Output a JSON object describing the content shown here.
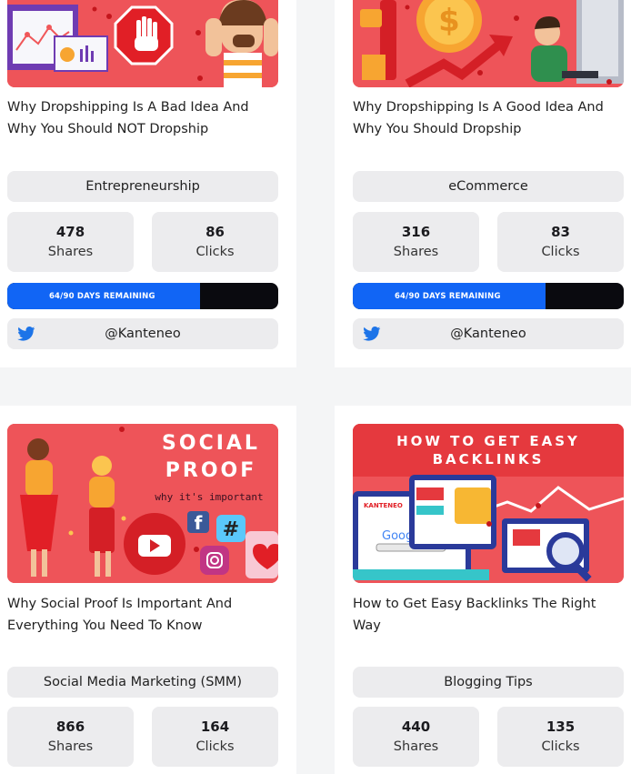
{
  "cards": [
    {
      "title_line1": "Why Dropshipping Is A Bad Idea And",
      "title_line2": "Why You Should NOT Dropship",
      "category": "Entrepreneurship",
      "shares": "478",
      "shares_label": "Shares",
      "clicks": "86",
      "clicks_label": "Clicks",
      "progress_text": "64/90 DAYS REMAINING",
      "progress_fraction": 0.71,
      "twitter_handle": "@Kanteneo"
    },
    {
      "title_line1": "Why Dropshipping Is A Good Idea And",
      "title_line2": "Why You Should Dropship",
      "category": "eCommerce",
      "shares": "316",
      "shares_label": "Shares",
      "clicks": "83",
      "clicks_label": "Clicks",
      "progress_text": "64/90 DAYS REMAINING",
      "progress_fraction": 0.71,
      "twitter_handle": "@Kanteneo"
    },
    {
      "title_line1": "Why Social Proof Is Important And",
      "title_line2": "Everything You Need To Know",
      "category": "Social Media Marketing (SMM)",
      "shares": "866",
      "shares_label": "Shares",
      "clicks": "164",
      "clicks_label": "Clicks",
      "image_text_1": "SOCIAL",
      "image_text_2": "PROOF",
      "image_text_3": "why it's important"
    },
    {
      "title_line1": "How to Get Easy Backlinks The Right",
      "title_line2": "Way",
      "category": "Blogging Tips",
      "shares": "440",
      "shares_label": "Shares",
      "clicks": "135",
      "clicks_label": "Clicks",
      "image_text_1": "HOW TO GET EASY",
      "image_text_2": "BACKLINKS",
      "image_logo": "KANTENEO",
      "image_google": "Google"
    }
  ],
  "colors": {
    "thumb_red": "#f05759",
    "progress_fill": "#1165f5",
    "progress_track": "#0a0a0f",
    "twitter_blue": "#1d9bf0",
    "chip_gray": "#ececee"
  }
}
